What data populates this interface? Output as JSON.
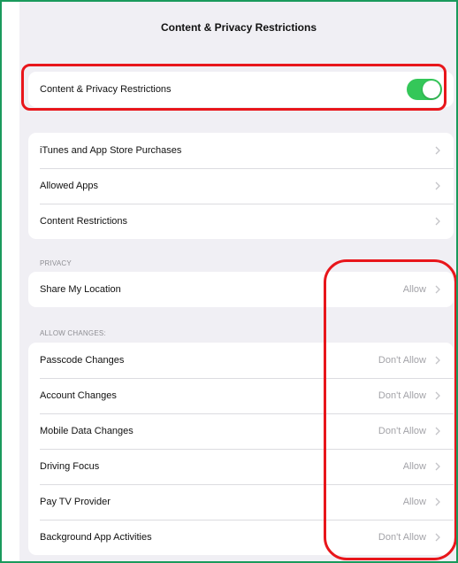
{
  "header": {
    "title": "Content & Privacy Restrictions"
  },
  "master": {
    "label": "Content & Privacy Restrictions",
    "enabled": true
  },
  "store_group": [
    {
      "label": "iTunes and App Store Purchases"
    },
    {
      "label": "Allowed Apps"
    },
    {
      "label": "Content Restrictions"
    }
  ],
  "privacy": {
    "header": "PRIVACY",
    "items": [
      {
        "label": "Share My Location",
        "value": "Allow"
      }
    ]
  },
  "allow_changes": {
    "header": "ALLOW CHANGES:",
    "items": [
      {
        "label": "Passcode Changes",
        "value": "Don't Allow"
      },
      {
        "label": "Account Changes",
        "value": "Don't Allow"
      },
      {
        "label": "Mobile Data Changes",
        "value": "Don't Allow"
      },
      {
        "label": "Driving Focus",
        "value": "Allow"
      },
      {
        "label": "Pay TV Provider",
        "value": "Allow"
      },
      {
        "label": "Background App Activities",
        "value": "Don't Allow"
      }
    ]
  },
  "colors": {
    "toggle_on": "#34c759",
    "annotation_red": "#e8161b",
    "frame_green": "#1a9a5c"
  }
}
